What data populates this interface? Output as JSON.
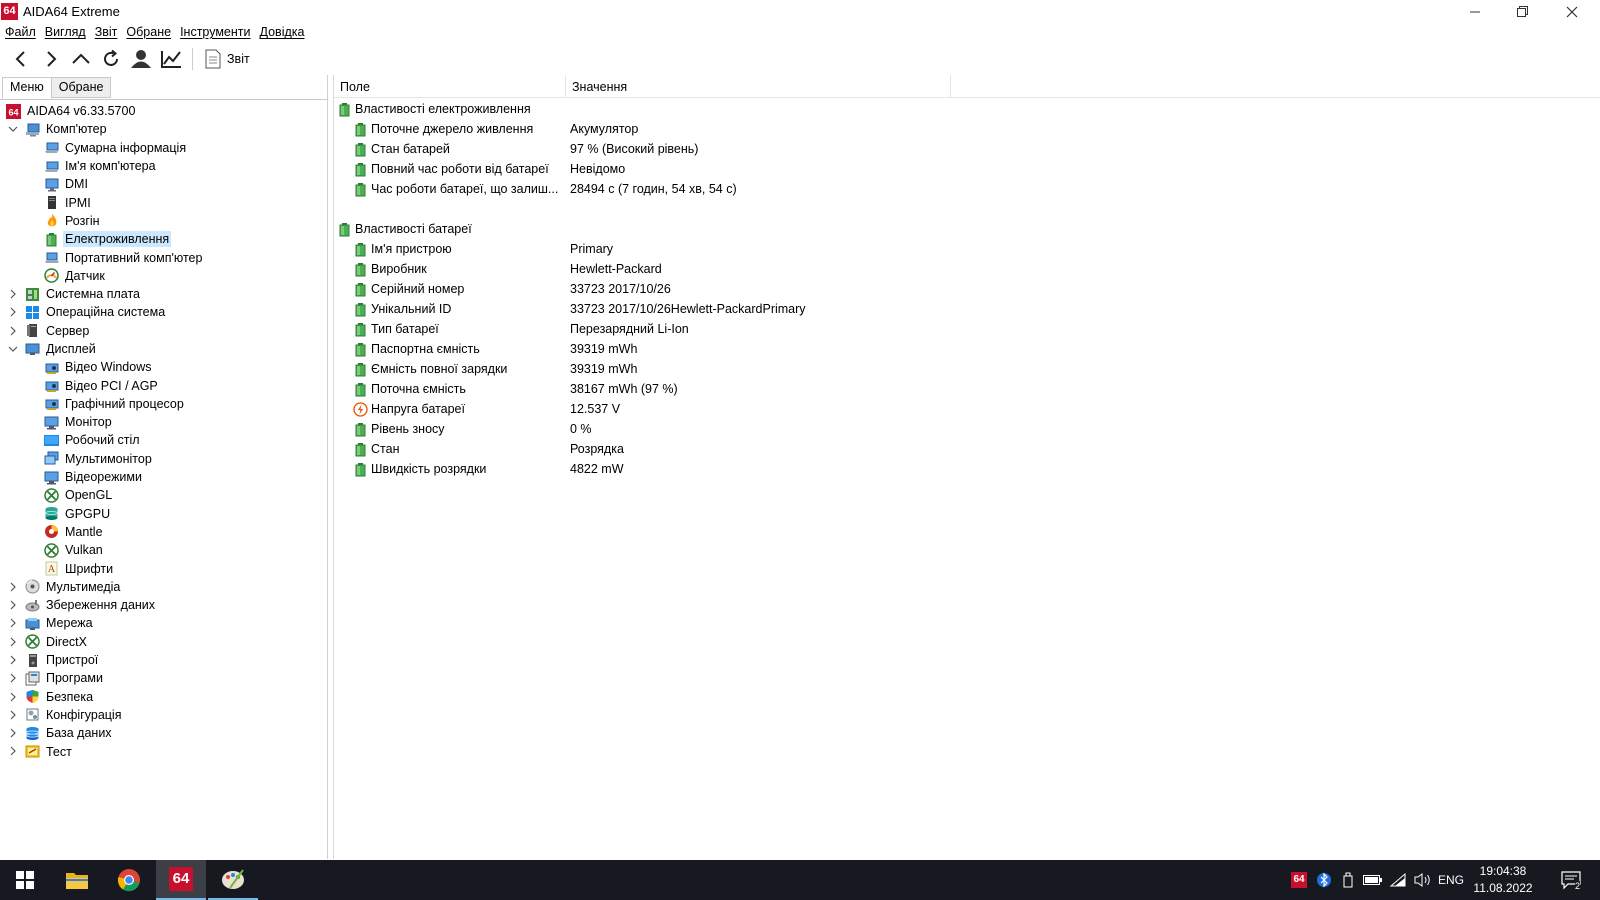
{
  "window": {
    "logo_text": "64",
    "title": "AIDA64 Extreme"
  },
  "menu": [
    "Файл",
    "Вигляд",
    "Звіт",
    "Обране",
    "Інструменти",
    "Довідка"
  ],
  "toolbar": {
    "report_label": "Звіт"
  },
  "tabs": [
    "Меню",
    "Обране"
  ],
  "tree": [
    {
      "label": "AIDA64 v6.33.5700",
      "level": 0,
      "expander": "",
      "icon": "aida64-icon"
    },
    {
      "label": "Комп'ютер",
      "level": 1,
      "expander": "expanded",
      "icon": "computer-icon"
    },
    {
      "label": "Сумарна інформація",
      "level": 2,
      "expander": "",
      "icon": "computer-small-icon"
    },
    {
      "label": "Ім'я комп'ютера",
      "level": 2,
      "expander": "",
      "icon": "computer-small-icon"
    },
    {
      "label": "DMI",
      "level": 2,
      "expander": "",
      "icon": "monitor-small-icon"
    },
    {
      "label": "IPMI",
      "level": 2,
      "expander": "",
      "icon": "tower-icon"
    },
    {
      "label": "Розгін",
      "level": 2,
      "expander": "",
      "icon": "flame-icon"
    },
    {
      "label": "Електроживлення",
      "level": 2,
      "expander": "",
      "icon": "battery-icon",
      "selected": true
    },
    {
      "label": "Портативний комп'ютер",
      "level": 2,
      "expander": "",
      "icon": "laptop-icon"
    },
    {
      "label": "Датчик",
      "level": 2,
      "expander": "",
      "icon": "gauge-icon"
    },
    {
      "label": "Системна плата",
      "level": 1,
      "expander": "collapsed",
      "icon": "motherboard-icon"
    },
    {
      "label": "Операційна система",
      "level": 1,
      "expander": "collapsed",
      "icon": "windows-icon"
    },
    {
      "label": "Сервер",
      "level": 1,
      "expander": "collapsed",
      "icon": "server-icon"
    },
    {
      "label": "Дисплей",
      "level": 1,
      "expander": "expanded",
      "icon": "display-icon"
    },
    {
      "label": "Відео Windows",
      "level": 2,
      "expander": "",
      "icon": "video-card-icon"
    },
    {
      "label": "Відео PCI / AGP",
      "level": 2,
      "expander": "",
      "icon": "video-card-icon"
    },
    {
      "label": "Графічний процесор",
      "level": 2,
      "expander": "",
      "icon": "video-card-icon"
    },
    {
      "label": "Монітор",
      "level": 2,
      "expander": "",
      "icon": "monitor-icon"
    },
    {
      "label": "Робочий стіл",
      "level": 2,
      "expander": "",
      "icon": "desktop-icon"
    },
    {
      "label": "Мультимонітор",
      "level": 2,
      "expander": "",
      "icon": "multimonitor-icon"
    },
    {
      "label": "Відеорежими",
      "level": 2,
      "expander": "",
      "icon": "monitor-icon"
    },
    {
      "label": "OpenGL",
      "level": 2,
      "expander": "",
      "icon": "xbox-icon"
    },
    {
      "label": "GPGPU",
      "level": 2,
      "expander": "",
      "icon": "gpgpu-icon"
    },
    {
      "label": "Mantle",
      "level": 2,
      "expander": "",
      "icon": "mantle-icon"
    },
    {
      "label": "Vulkan",
      "level": 2,
      "expander": "",
      "icon": "xbox-icon"
    },
    {
      "label": "Шрифти",
      "level": 2,
      "expander": "",
      "icon": "font-icon"
    },
    {
      "label": "Мультимедіа",
      "level": 1,
      "expander": "collapsed",
      "icon": "multimedia-icon"
    },
    {
      "label": "Збереження даних",
      "level": 1,
      "expander": "collapsed",
      "icon": "storage-icon"
    },
    {
      "label": "Мережа",
      "level": 1,
      "expander": "collapsed",
      "icon": "network-icon"
    },
    {
      "label": "DirectX",
      "level": 1,
      "expander": "collapsed",
      "icon": "xbox-icon"
    },
    {
      "label": "Пристрої",
      "level": 1,
      "expander": "collapsed",
      "icon": "devices-icon"
    },
    {
      "label": "Програми",
      "level": 1,
      "expander": "collapsed",
      "icon": "programs-icon"
    },
    {
      "label": "Безпека",
      "level": 1,
      "expander": "collapsed",
      "icon": "shield-icon"
    },
    {
      "label": "Конфігурація",
      "level": 1,
      "expander": "collapsed",
      "icon": "config-icon"
    },
    {
      "label": "База даних",
      "level": 1,
      "expander": "collapsed",
      "icon": "database-icon"
    },
    {
      "label": "Тест",
      "level": 1,
      "expander": "collapsed",
      "icon": "benchmark-icon"
    }
  ],
  "columns": [
    "Поле",
    "Значення"
  ],
  "details": [
    {
      "type": "section",
      "field": "Властивості електроживлення",
      "value": "",
      "icon": "battery-icon"
    },
    {
      "type": "item",
      "field": "Поточне джерело живлення",
      "value": "Акумулятор",
      "icon": "battery-icon"
    },
    {
      "type": "item",
      "field": "Стан батарей",
      "value": "97 % (Високий рівень)",
      "icon": "battery-icon"
    },
    {
      "type": "item",
      "field": "Повний час роботи від батареї",
      "value": "Невідомо",
      "icon": "battery-icon"
    },
    {
      "type": "item",
      "field": "Час роботи батареї, що залиш...",
      "value": "28494 с (7 годин, 54 хв, 54 с)",
      "icon": "battery-icon"
    },
    {
      "type": "blank",
      "field": "",
      "value": "",
      "icon": ""
    },
    {
      "type": "section",
      "field": "Властивості батареї",
      "value": "",
      "icon": "battery-icon"
    },
    {
      "type": "item",
      "field": "Ім'я пристрою",
      "value": "Primary",
      "icon": "battery-icon"
    },
    {
      "type": "item",
      "field": "Виробник",
      "value": "Hewlett-Packard",
      "icon": "battery-icon"
    },
    {
      "type": "item",
      "field": "Серійний номер",
      "value": "33723 2017/10/26",
      "icon": "battery-icon"
    },
    {
      "type": "item",
      "field": "Унікальний ID",
      "value": "33723 2017/10/26Hewlett-PackardPrimary",
      "icon": "battery-icon"
    },
    {
      "type": "item",
      "field": "Тип батареї",
      "value": "Перезарядний Li-Ion",
      "icon": "battery-icon"
    },
    {
      "type": "item",
      "field": "Паспортна ємність",
      "value": "39319 mWh",
      "icon": "battery-icon"
    },
    {
      "type": "item",
      "field": "Ємність повної зарядки",
      "value": "39319 mWh",
      "icon": "battery-icon"
    },
    {
      "type": "item",
      "field": "Поточна ємність",
      "value": "38167 mWh  (97 %)",
      "icon": "battery-icon"
    },
    {
      "type": "item",
      "field": "Напруга батареї",
      "value": "12.537 V",
      "icon": "voltage-icon"
    },
    {
      "type": "item",
      "field": "Рівень зносу",
      "value": "0 %",
      "icon": "battery-icon"
    },
    {
      "type": "item",
      "field": "Стан",
      "value": "Розрядка",
      "icon": "battery-icon"
    },
    {
      "type": "item",
      "field": "Швидкість розрядки",
      "value": "4822 mW",
      "icon": "battery-icon"
    }
  ],
  "taskbar": {
    "apps": [
      "start",
      "file-explorer",
      "chrome",
      "aida64",
      "paint"
    ],
    "aida64_label": "64",
    "tray_aida64_label": "64",
    "language": "ENG",
    "time": "19:04:38",
    "date": "11.08.2022",
    "notification_count": "2"
  },
  "colors": {
    "accent": "#c8102e",
    "selection": "#cce8ff",
    "battery_green": "#4caf50",
    "taskbar_bg": "#16191f"
  }
}
